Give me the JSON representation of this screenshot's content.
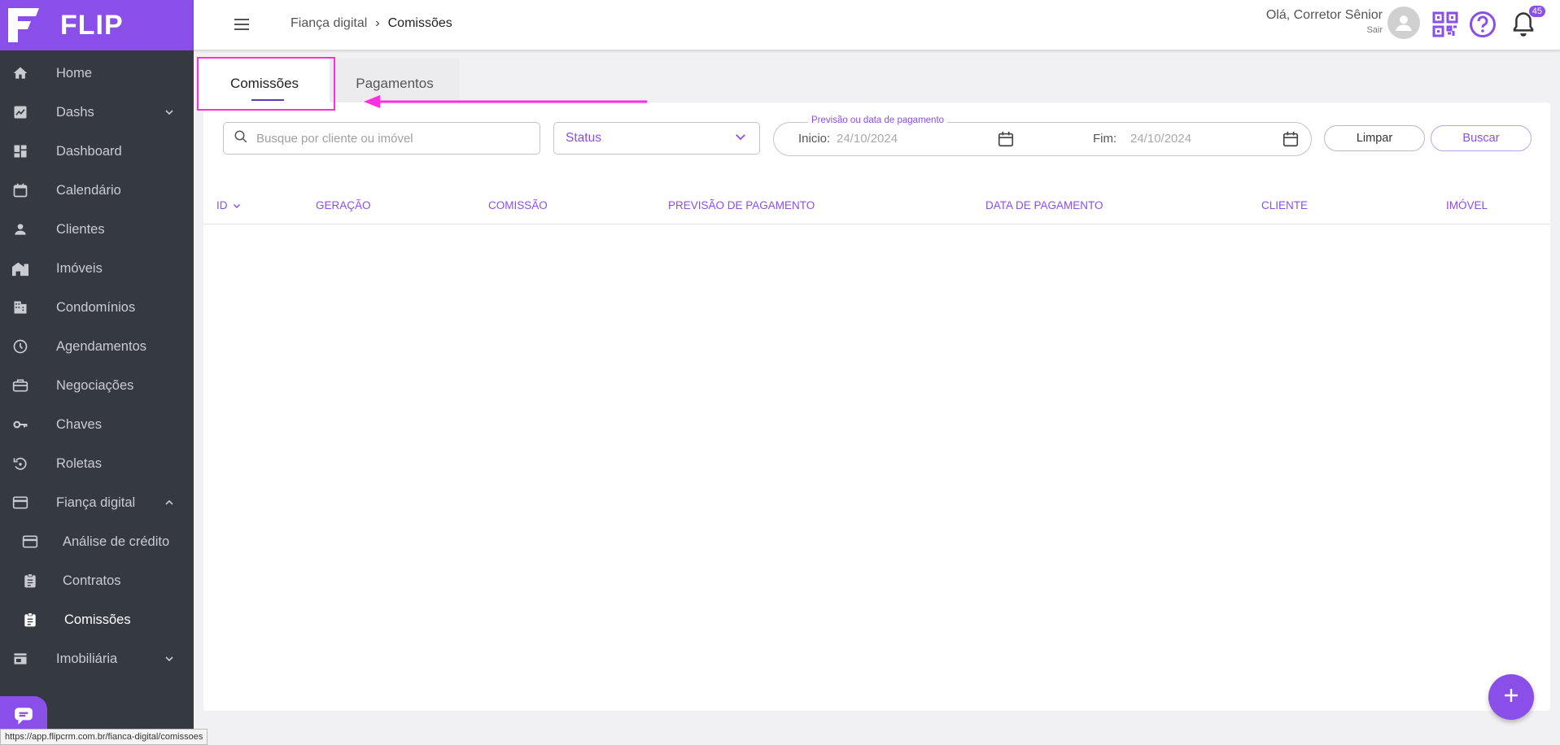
{
  "brand": {
    "name": "FLIP",
    "accent": "#8a4fe8",
    "sidebar_bg": "#343a40"
  },
  "sidebar": {
    "items": [
      {
        "label": "Home",
        "icon": "home-icon"
      },
      {
        "label": "Dashs",
        "icon": "chart-icon",
        "expand": "chevron-down"
      },
      {
        "label": "Dashboard",
        "icon": "dashboard-icon"
      },
      {
        "label": "Calendário",
        "icon": "calendar-icon"
      },
      {
        "label": "Clientes",
        "icon": "person-icon"
      },
      {
        "label": "Imóveis",
        "icon": "building-icon"
      },
      {
        "label": "Condomínios",
        "icon": "apartment-icon"
      },
      {
        "label": "Agendamentos",
        "icon": "clock-icon"
      },
      {
        "label": "Negociações",
        "icon": "briefcase-icon"
      },
      {
        "label": "Chaves",
        "icon": "key-icon"
      },
      {
        "label": "Roletas",
        "icon": "rotate-icon"
      },
      {
        "label": "Fiança digital",
        "icon": "card-icon",
        "expand": "chevron-up"
      },
      {
        "label": "Análise de crédito",
        "icon": "card-icon"
      },
      {
        "label": "Contratos",
        "icon": "clipboard-icon"
      },
      {
        "label": "Comissões",
        "icon": "clipboard-icon"
      },
      {
        "label": "Imobiliária",
        "icon": "store-icon",
        "expand": "chevron-down"
      }
    ],
    "active_item": "Comissões"
  },
  "header": {
    "breadcrumb": {
      "parent": "Fiança digital",
      "separator": "›",
      "current": "Comissões"
    },
    "greeting": "Olá, Corretor Sênior",
    "logout_label": "Sair",
    "notification_count": "45"
  },
  "tabs": [
    {
      "label": "Comissões",
      "active": true
    },
    {
      "label": "Pagamentos",
      "active": false
    }
  ],
  "filters": {
    "search_placeholder": "Busque por cliente ou imóvel",
    "status_label": "Status",
    "date_range_legend": "Previsão ou data de pagamento",
    "start_label": "Inicio:",
    "start_value": "24/10/2024",
    "end_label": "Fim:",
    "end_value": "24/10/2024",
    "clear_label": "Limpar",
    "search_label": "Buscar"
  },
  "table": {
    "columns": [
      "ID",
      "GERAÇÃO",
      "COMISSÃO",
      "PREVISÃO DE PAGAMENTO",
      "DATA DE PAGAMENTO",
      "CLIENTE",
      "IMÓVEL"
    ],
    "rows": []
  },
  "status_bar_url": "https://app.flipcrm.com.br/fianca-digital/comissoes",
  "annotation_color": "#ff2ee0"
}
